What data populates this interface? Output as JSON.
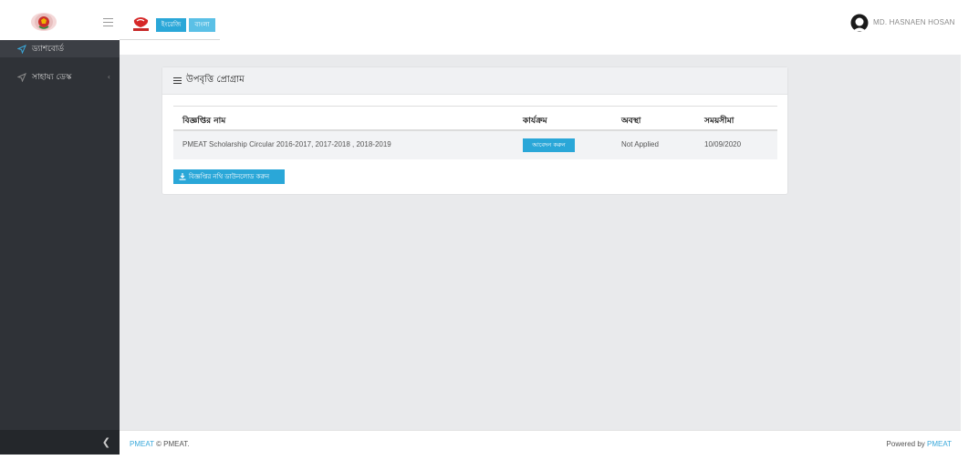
{
  "header": {
    "lang_en_label": "ইংরেজি",
    "lang_bn_label": "বাংলা",
    "user_name": "MD. HASNAEN HOSAN"
  },
  "sidebar": {
    "items": [
      {
        "label": "ড্যাশবোর্ড",
        "icon": "send-icon"
      },
      {
        "label": "সাহায্য ডেস্ক",
        "icon": "send-icon"
      }
    ]
  },
  "panel": {
    "title": "উপবৃত্তি প্রোগ্রাম",
    "columns": [
      "বিজ্ঞপ্তির নাম",
      "কার্যক্রম",
      "অবস্থা",
      "সময়সীমা"
    ],
    "rows": [
      {
        "name": "PMEAT Scholarship Circular 2016-2017, 2017-2018 , 2018-2019",
        "action": "আবেদন করুন",
        "status": "Not Applied",
        "deadline": "10/09/2020"
      }
    ],
    "download_label": "বিজ্ঞপ্তির নথি ডাউনলোড করুন"
  },
  "footer": {
    "brand_link": "PMEAT",
    "copyright": "© PMEAT.",
    "powered_by": "Powered by",
    "powered_link": "PMEAT"
  },
  "colors": {
    "accent": "#2aa7d8",
    "sidebar_bg": "#2f3237",
    "content_bg": "#e9eaec"
  }
}
